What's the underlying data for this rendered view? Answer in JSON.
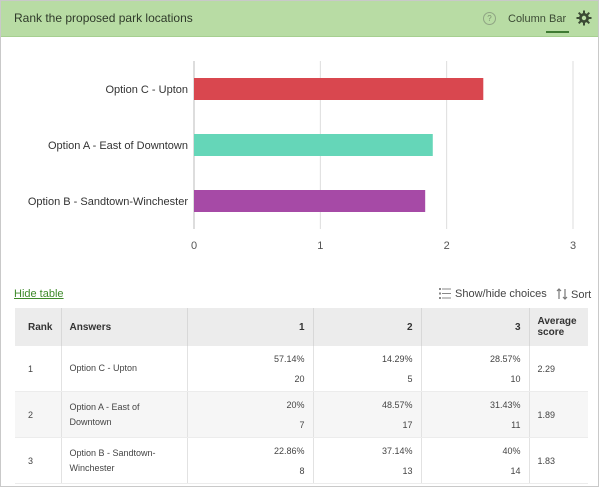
{
  "header": {
    "title": "Rank the proposed park locations",
    "help_glyph": "?",
    "tabs": [
      "Column",
      "Bar"
    ],
    "active_tab": "Bar"
  },
  "chart_data": {
    "type": "bar",
    "orientation": "horizontal",
    "categories": [
      "Option C - Upton",
      "Option A - East of Downtown",
      "Option B - Sandtown-Winchester"
    ],
    "values": [
      2.29,
      1.89,
      1.83
    ],
    "colors": [
      "#d9474f",
      "#65d6b8",
      "#a64aa6"
    ],
    "xlim": [
      0,
      3
    ],
    "xticks": [
      "0",
      "1",
      "2",
      "3"
    ],
    "grid": true
  },
  "controls": {
    "hide_table": "Hide table",
    "show_hide_choices": "Show/hide choices",
    "sort": "Sort"
  },
  "table": {
    "headers": [
      "Rank",
      "Answers",
      "1",
      "2",
      "3",
      "Average score"
    ],
    "rows": [
      {
        "rank": "1",
        "answer": "Option C - Upton",
        "c1_pct": "57.14%",
        "c1_n": "20",
        "c2_pct": "14.29%",
        "c2_n": "5",
        "c3_pct": "28.57%",
        "c3_n": "10",
        "avg": "2.29"
      },
      {
        "rank": "2",
        "answer": "Option A - East of Downtown",
        "c1_pct": "20%",
        "c1_n": "7",
        "c2_pct": "48.57%",
        "c2_n": "17",
        "c3_pct": "31.43%",
        "c3_n": "11",
        "avg": "1.89"
      },
      {
        "rank": "3",
        "answer": "Option B - Sandtown-Winchester",
        "c1_pct": "22.86%",
        "c1_n": "8",
        "c2_pct": "37.14%",
        "c2_n": "13",
        "c3_pct": "40%",
        "c3_n": "14",
        "avg": "1.83"
      }
    ]
  }
}
